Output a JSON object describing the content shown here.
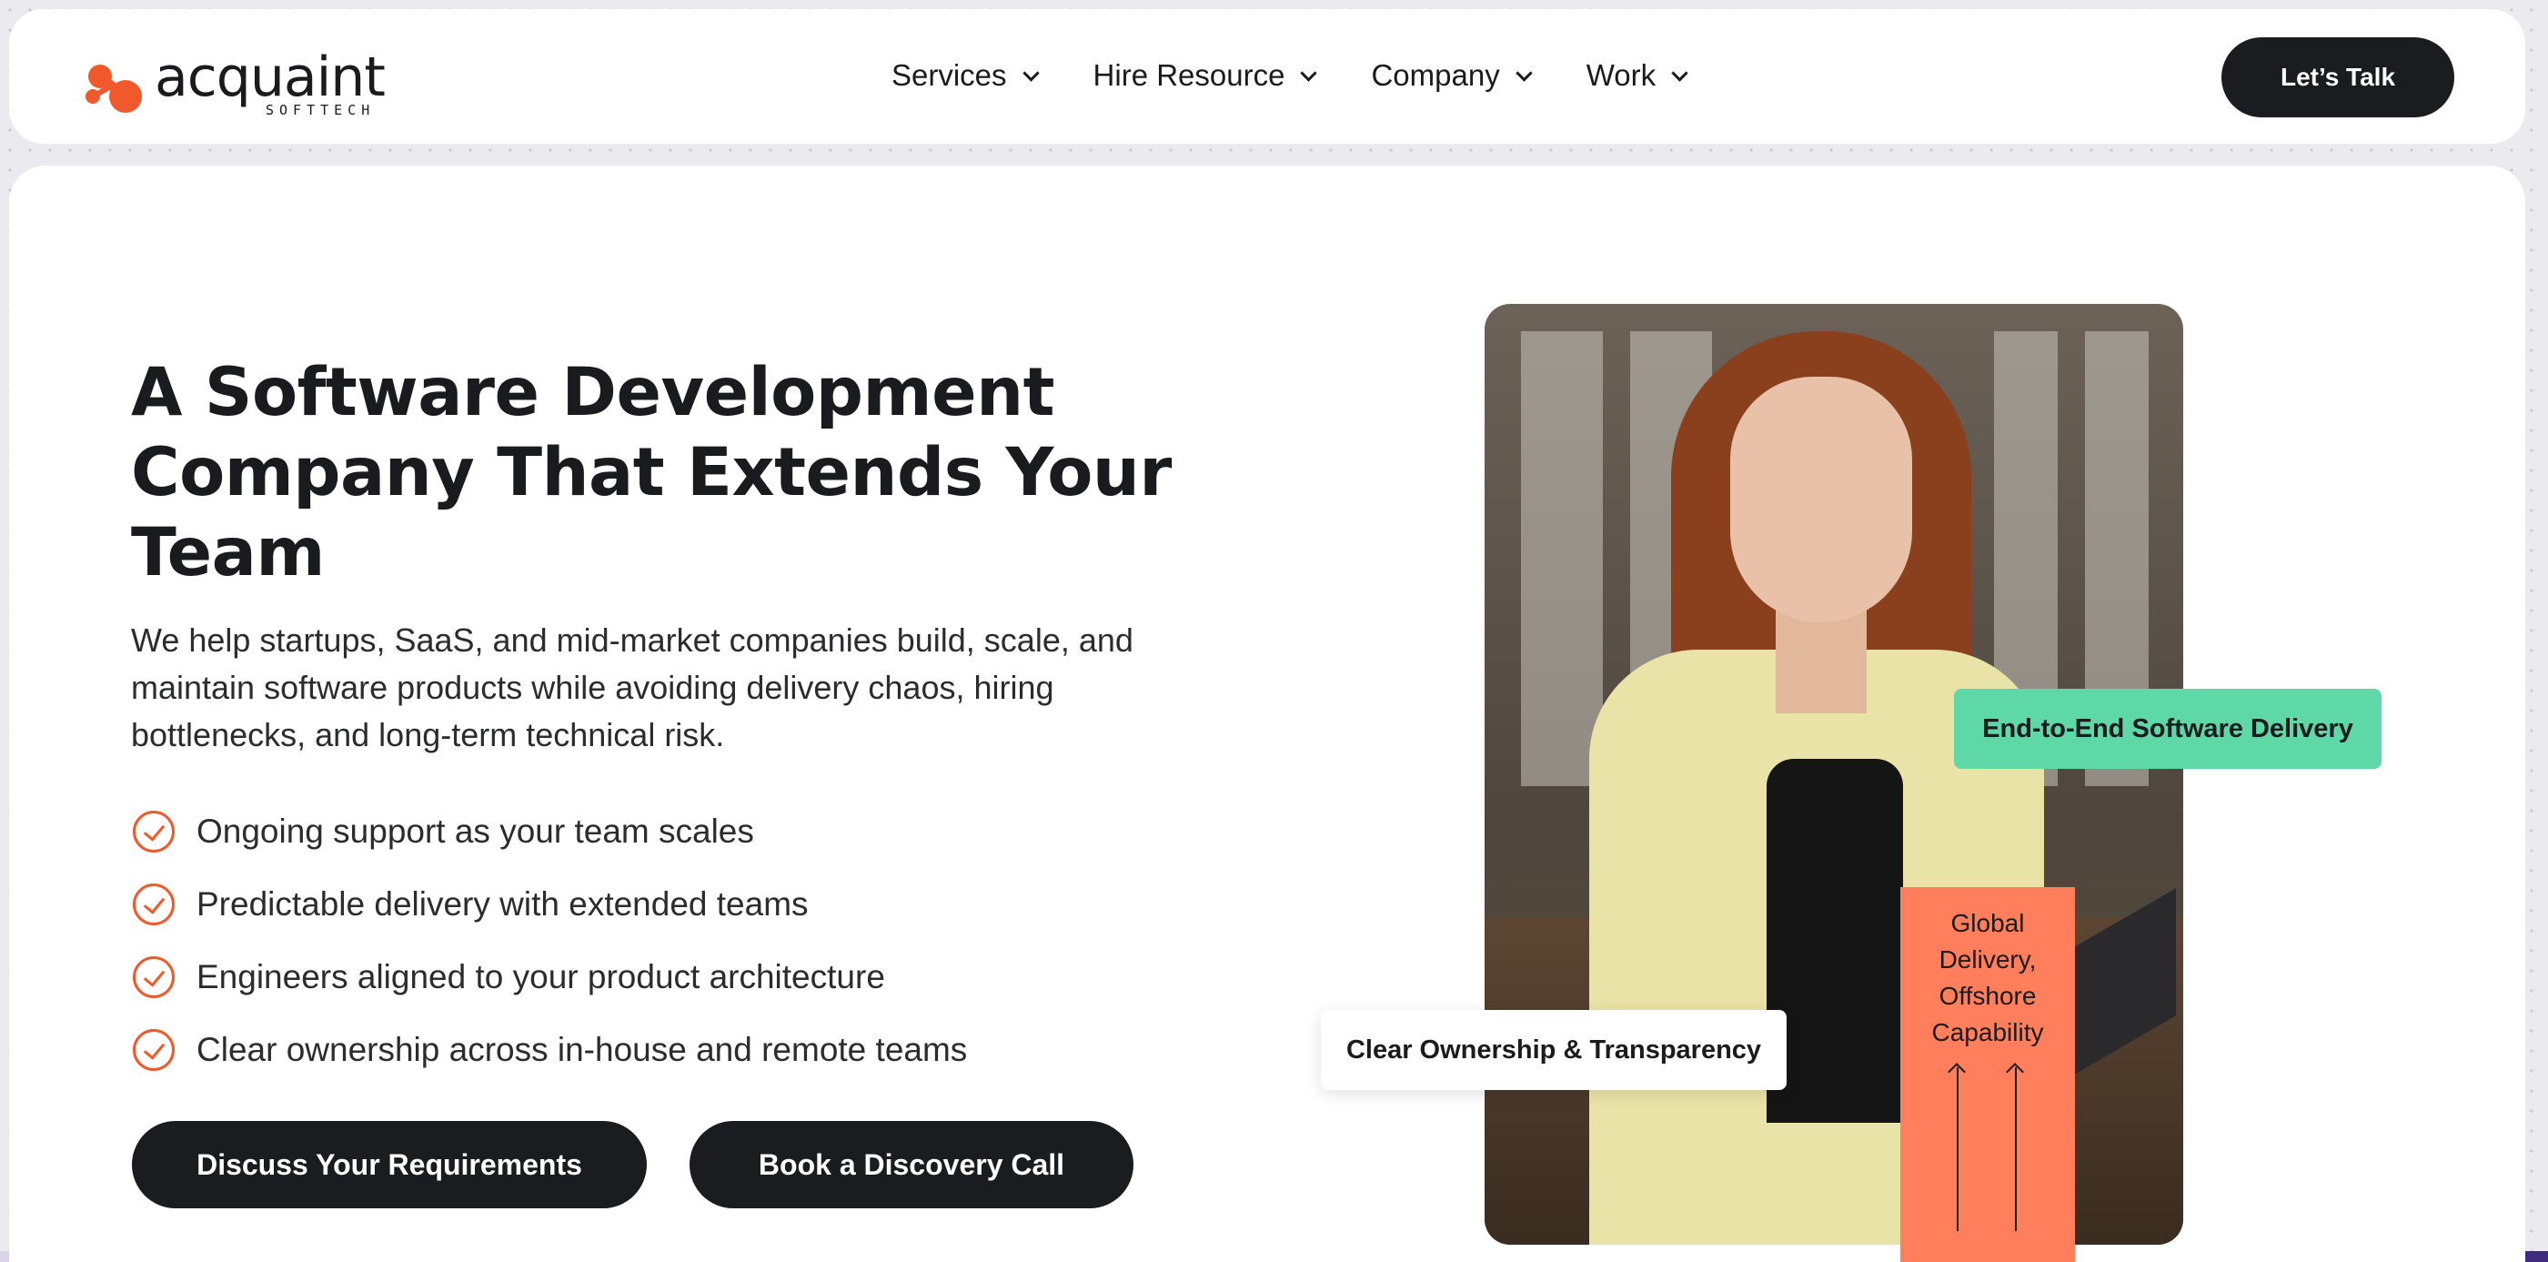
{
  "brand": {
    "logo_word": "acquaint",
    "logo_sub": "SOFTTECH",
    "accent_color": "#f0592c"
  },
  "nav": {
    "items": [
      {
        "label": "Services"
      },
      {
        "label": "Hire Resource"
      },
      {
        "label": "Company"
      },
      {
        "label": "Work"
      }
    ],
    "cta_label": "Let’s Talk"
  },
  "hero": {
    "headline": "A Software Development Company That Extends Your Team",
    "subtext": "We help startups, SaaS, and mid-market companies build, scale, and maintain software products while avoiding delivery chaos, hiring bottlenecks, and long-term technical risk.",
    "bullets": [
      "Ongoing support as your team scales",
      "Predictable delivery with extended teams",
      "Engineers aligned to your product architecture",
      "Clear ownership across in-house and remote teams"
    ],
    "cta_primary": "Discuss Your Requirements",
    "cta_secondary": "Book a Discovery Call"
  },
  "badges": {
    "green": "End-to-End Software Delivery",
    "white": "Clear Ownership & Transparency",
    "orange": "Global Delivery, Offshore Capability"
  }
}
